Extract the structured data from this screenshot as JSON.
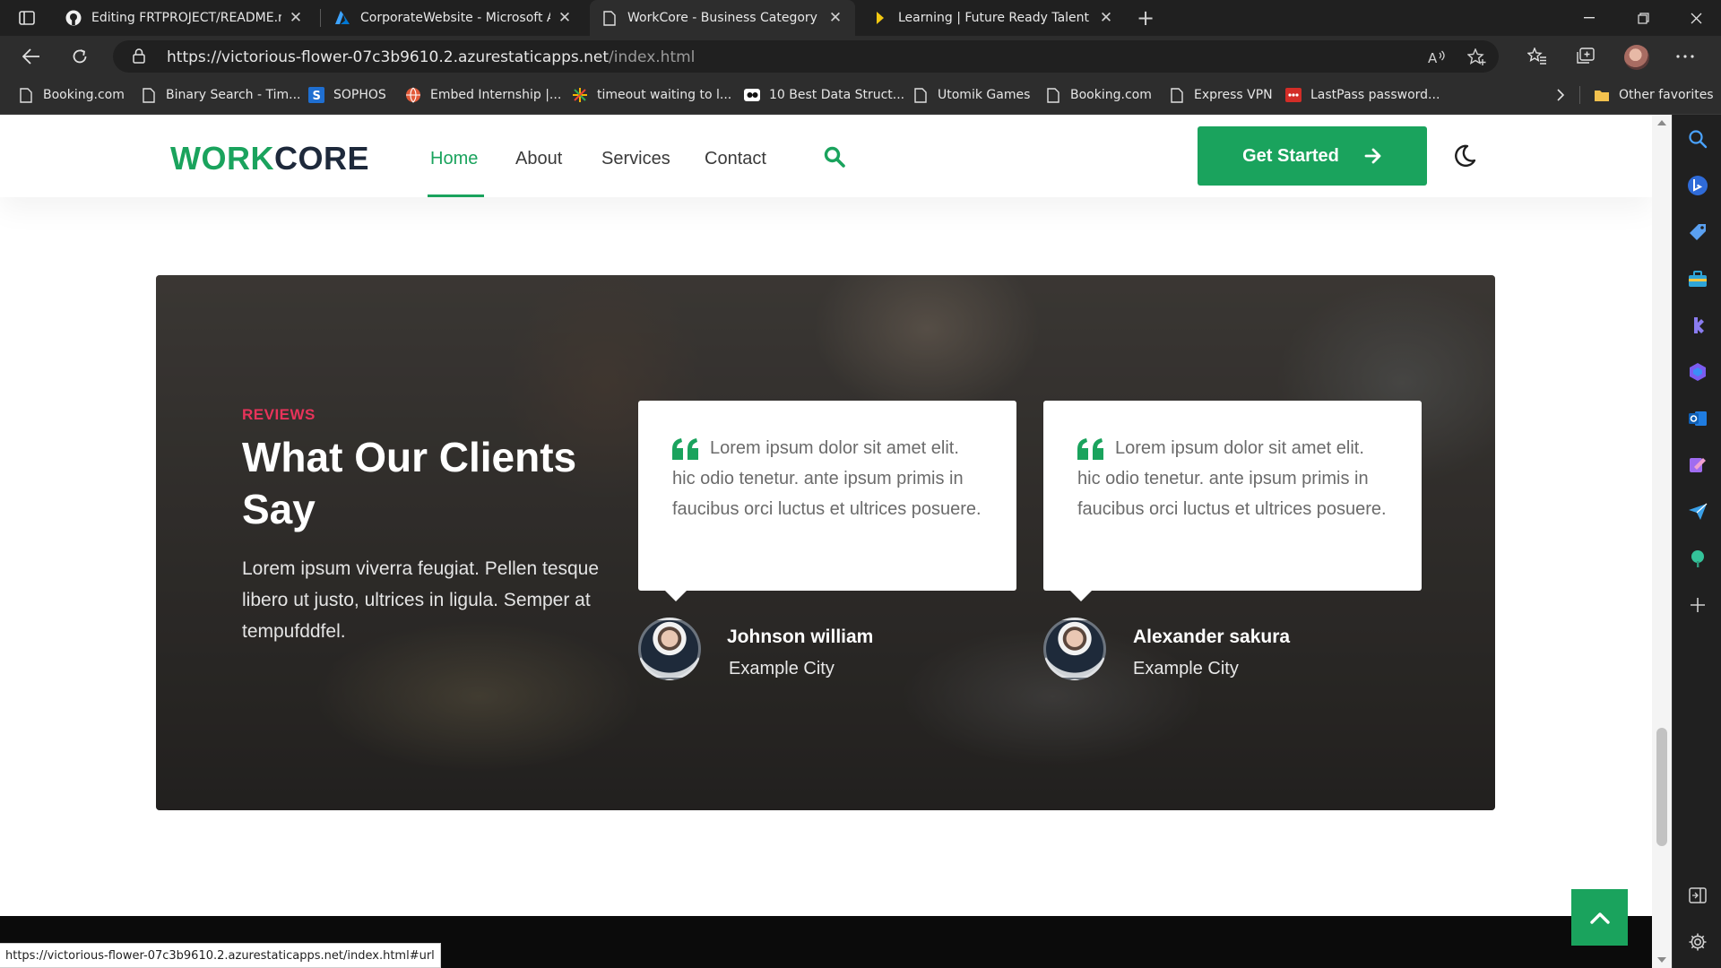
{
  "browser": {
    "tabs": [
      {
        "title": "Editing FRTPROJECT/README.md",
        "icon": "github-icon",
        "active": false
      },
      {
        "title": "CorporateWebsite - Microsoft Azure",
        "icon": "azure-icon",
        "active": false
      },
      {
        "title": "WorkCore - Business Category Bootstrap",
        "icon": "page-icon",
        "active": true
      },
      {
        "title": "Learning | Future Ready Talent",
        "icon": "frt-icon",
        "active": false
      }
    ],
    "url_host": "https://victorious-flower-07c3b9610.2.azurestaticapps.net",
    "url_path": "/index.html",
    "bookmarks": [
      {
        "label": "Booking.com",
        "icon": "page-icon"
      },
      {
        "label": "Binary Search - Tim...",
        "icon": "page-icon"
      },
      {
        "label": "SOPHOS",
        "icon": "sophos-icon"
      },
      {
        "label": "Embed Internship |...",
        "icon": "globe-icon"
      },
      {
        "label": "timeout waiting to l...",
        "icon": "spark-icon"
      },
      {
        "label": "10 Best Data Struct...",
        "icon": "media-icon"
      },
      {
        "label": "Utomik Games",
        "icon": "page-icon"
      },
      {
        "label": "Booking.com",
        "icon": "page-icon"
      },
      {
        "label": "Express VPN",
        "icon": "page-icon"
      },
      {
        "label": "LastPass password...",
        "icon": "lastpass-icon"
      }
    ],
    "other_favorites": "Other favorites",
    "status_url": "https://victorious-flower-07c3b9610.2.azurestaticapps.net/index.html#url"
  },
  "site": {
    "logo_green": "WORK",
    "logo_dark": "CORE",
    "nav": [
      {
        "label": "Home",
        "active": true
      },
      {
        "label": "About",
        "active": false
      },
      {
        "label": "Services",
        "active": false
      },
      {
        "label": "Contact",
        "active": false
      }
    ],
    "cta_label": "Get Started",
    "accent": "#1aa35d",
    "eyebrow_color": "#e8335a"
  },
  "reviews": {
    "eyebrow": "REVIEWS",
    "title": "What Our Clients Say",
    "description": "Lorem ipsum viverra feugiat. Pellen tesque libero ut justo, ultrices in ligula. Semper at tempufddfel.",
    "items": [
      {
        "quote": "Lorem ipsum dolor sit amet elit. hic odio tenetur. ante ipsum primis in faucibus orci luctus et ultrices posuere.",
        "name": "Johnson william",
        "city": "Example City"
      },
      {
        "quote": "Lorem ipsum dolor sit amet elit. hic odio tenetur. ante ipsum primis in faucibus orci luctus et ultrices posuere.",
        "name": "Alexander sakura",
        "city": "Example City"
      }
    ]
  }
}
